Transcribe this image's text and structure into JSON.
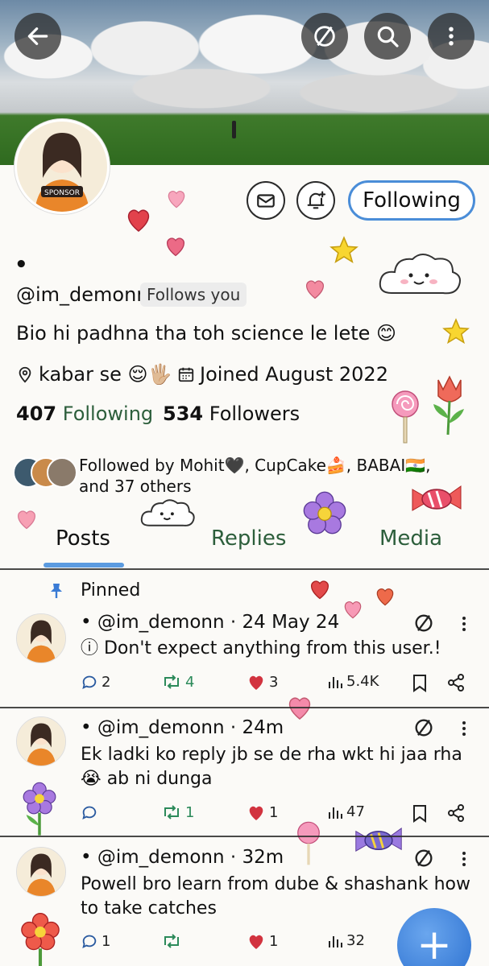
{
  "header": {
    "back_icon": "back-arrow-icon",
    "mute_icon": "no-entry-icon",
    "search_icon": "search-icon",
    "more_icon": "more-vertical-icon"
  },
  "profile": {
    "avatar_badge": "SPONSOR",
    "display_name": "•",
    "handle": "@im_demonn",
    "follows_you": "Follows you",
    "bio": "Bio hi padhna tha toh science le lete 😊",
    "location": "kabar se 😌🖐🏼",
    "joined": "Joined August 2022",
    "following_count": "407",
    "following_label": "Following",
    "followers_count": "534",
    "followers_label": "Followers",
    "followed_by": "Followed by Mohit🖤, CupCake🍰, BABAI🇮🇳, and 37 others",
    "following_button": "Following"
  },
  "tabs": [
    {
      "label": "Posts",
      "selected": true
    },
    {
      "label": "Replies",
      "selected": false
    },
    {
      "label": "Media",
      "selected": false
    }
  ],
  "posts": [
    {
      "pinned_label": "Pinned",
      "author": "• @im_demonn",
      "time": "· 24 May 24",
      "text": "ⓘ Don't expect anything from this user.!",
      "replies": "2",
      "reposts": "4",
      "likes": "3",
      "views": "5.4K"
    },
    {
      "author": "• @im_demonn",
      "time": "· 24m",
      "text": "Ek ladki ko reply jb se de rha wkt hi jaa rha 😭 ab ni dunga",
      "replies": "",
      "reposts": "1",
      "likes": "1",
      "views": "47"
    },
    {
      "author": "• @im_demonn",
      "time": "· 32m",
      "text": "Powell bro learn from dube & shashank how to take catches",
      "replies": "1",
      "reposts": "",
      "likes": "1",
      "views": "32"
    }
  ],
  "fab": {
    "label": "+"
  },
  "colors": {
    "accent_blue": "#4a8dd8",
    "green_text": "#2c5e3b",
    "like_red": "#d2333f",
    "repost_green": "#2c8a5a"
  }
}
